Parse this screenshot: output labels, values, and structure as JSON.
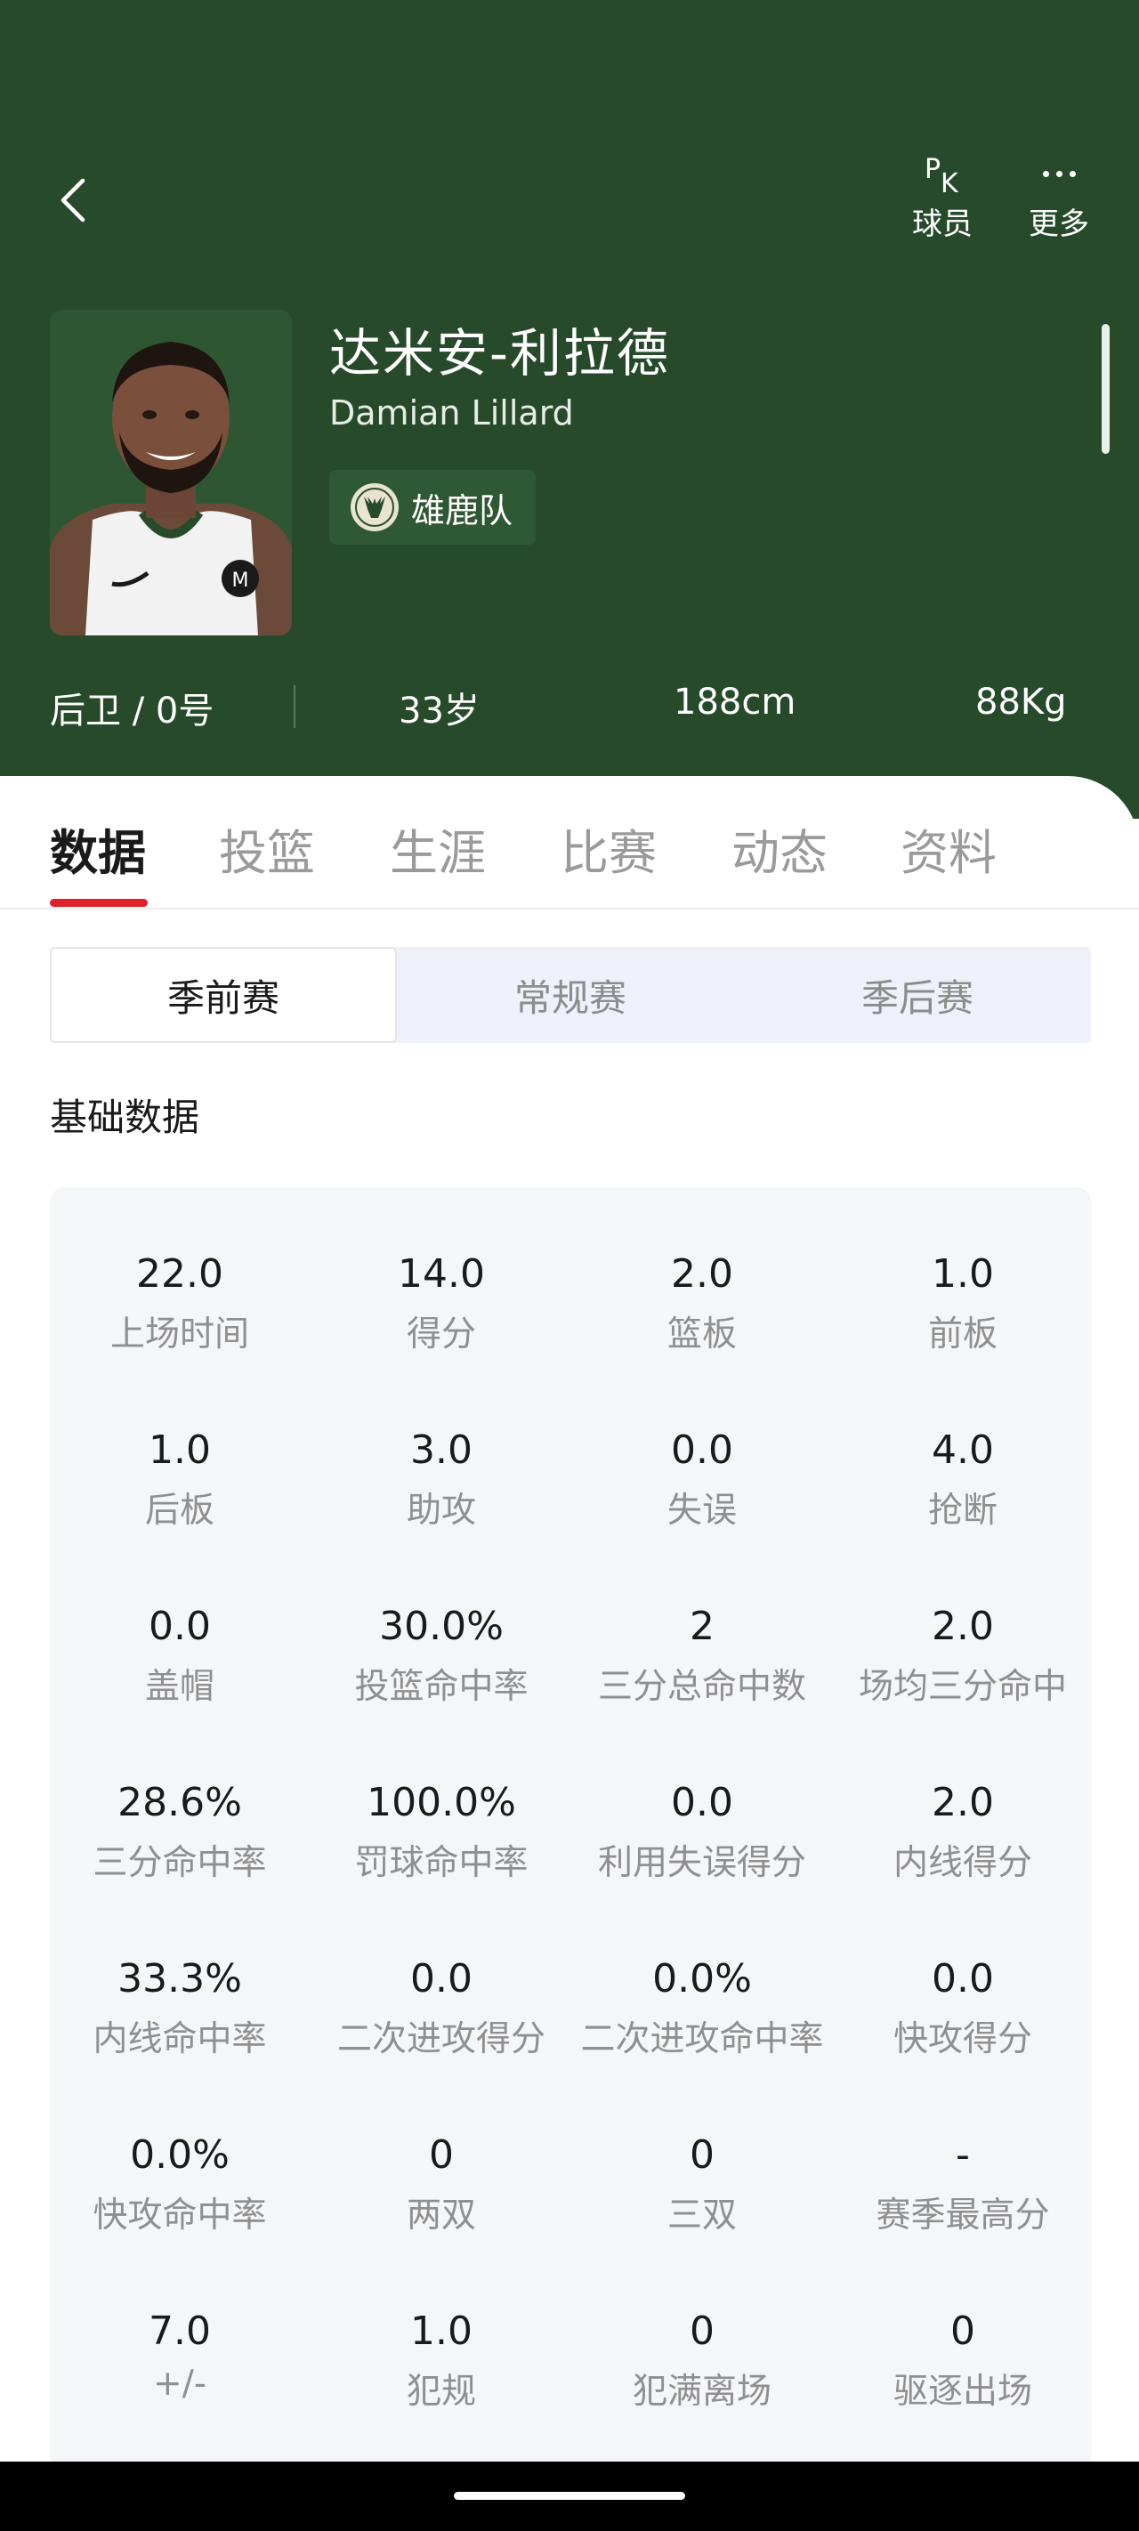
{
  "header": {
    "actions": [
      {
        "icon": "pk-icon",
        "label": "球员"
      },
      {
        "icon": "more-dots-icon",
        "label": "更多"
      }
    ],
    "player": {
      "name_cn": "达米安-利拉德",
      "name_en": "Damian Lillard",
      "team": "雄鹿队"
    },
    "info": {
      "position": "后卫 / 0号",
      "age": "33岁",
      "height": "188cm",
      "weight": "88Kg"
    },
    "colors": {
      "background": "#274b2a",
      "accent": "#e0202c"
    }
  },
  "tabs": [
    "数据",
    "投篮",
    "生涯",
    "比赛",
    "动态",
    "资料"
  ],
  "active_tab": "数据",
  "segments": [
    "季前赛",
    "常规赛",
    "季后赛"
  ],
  "active_segment": "季前赛",
  "section_title": "基础数据",
  "stats": [
    {
      "value": "22.0",
      "label": "上场时间"
    },
    {
      "value": "14.0",
      "label": "得分"
    },
    {
      "value": "2.0",
      "label": "篮板"
    },
    {
      "value": "1.0",
      "label": "前板"
    },
    {
      "value": "1.0",
      "label": "后板"
    },
    {
      "value": "3.0",
      "label": "助攻"
    },
    {
      "value": "0.0",
      "label": "失误"
    },
    {
      "value": "4.0",
      "label": "抢断"
    },
    {
      "value": "0.0",
      "label": "盖帽"
    },
    {
      "value": "30.0%",
      "label": "投篮命中率"
    },
    {
      "value": "2",
      "label": "三分总命中数"
    },
    {
      "value": "2.0",
      "label": "场均三分命中"
    },
    {
      "value": "28.6%",
      "label": "三分命中率"
    },
    {
      "value": "100.0%",
      "label": "罚球命中率"
    },
    {
      "value": "0.0",
      "label": "利用失误得分"
    },
    {
      "value": "2.0",
      "label": "内线得分"
    },
    {
      "value": "33.3%",
      "label": "内线命中率"
    },
    {
      "value": "0.0",
      "label": "二次进攻得分"
    },
    {
      "value": "0.0%",
      "label": "二次进攻命中率"
    },
    {
      "value": "0.0",
      "label": "快攻得分"
    },
    {
      "value": "0.0%",
      "label": "快攻命中率"
    },
    {
      "value": "0",
      "label": "两双"
    },
    {
      "value": "0",
      "label": "三双"
    },
    {
      "value": "-",
      "label": "赛季最高分"
    },
    {
      "value": "7.0",
      "label": "+/-"
    },
    {
      "value": "1.0",
      "label": "犯规"
    },
    {
      "value": "0",
      "label": "犯满离场"
    },
    {
      "value": "0",
      "label": "驱逐出场"
    }
  ]
}
